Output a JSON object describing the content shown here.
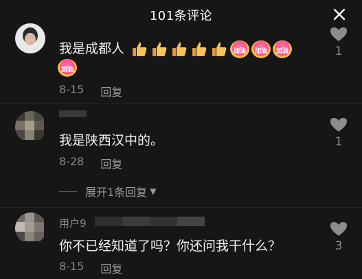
{
  "header": {
    "title": "101条评论",
    "close_icon": "close-icon"
  },
  "comments": [
    {
      "username": "",
      "text": "我是成都人",
      "emoji_thumbs": 5,
      "emoji_jiayou": 4,
      "emoji_jiayou_label": "加油",
      "date": "8-15",
      "reply_label": "回复",
      "likes": "1"
    },
    {
      "username": "",
      "text": "我是陕西汉中的。",
      "date": "8-28",
      "reply_label": "回复",
      "likes": "1",
      "expand_label": "展开1条回复"
    },
    {
      "username": "用户9",
      "text": "你不已经知道了吗？你还问我干什么？",
      "date": "8-15",
      "reply_label": "回复",
      "likes": "3"
    }
  ],
  "colors": {
    "background": "#161616",
    "text_primary": "#f2f2f2",
    "text_secondary": "#8a8a8a"
  }
}
